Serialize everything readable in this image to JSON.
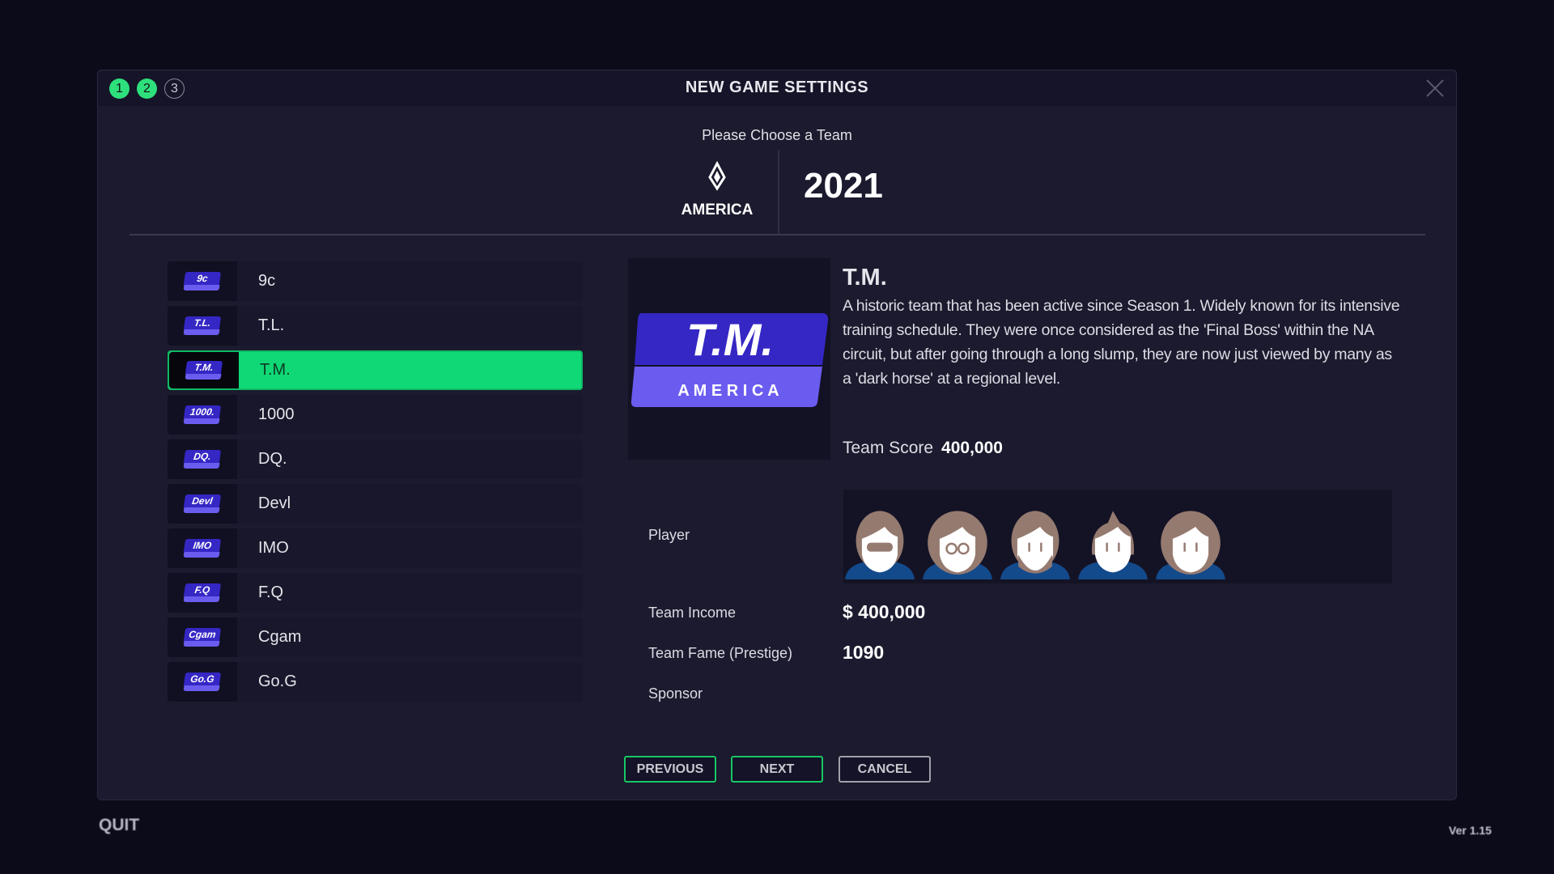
{
  "dialog": {
    "title": "NEW GAME  SETTINGS",
    "steps": [
      {
        "label": "1",
        "state": "done"
      },
      {
        "label": "2",
        "state": "done"
      },
      {
        "label": "3",
        "state": "todo"
      }
    ],
    "subtitle": "Please Choose a Team",
    "region": "AMERICA",
    "year": "2021"
  },
  "teams": [
    {
      "abbr": "9c",
      "name": "9c"
    },
    {
      "abbr": "T.L.",
      "name": "T.L."
    },
    {
      "abbr": "T.M.",
      "name": "T.M.",
      "selected": true
    },
    {
      "abbr": "1000.",
      "name": "1000"
    },
    {
      "abbr": "DQ.",
      "name": "DQ."
    },
    {
      "abbr": "Devl",
      "name": "Devl"
    },
    {
      "abbr": "IMO",
      "name": "IMO"
    },
    {
      "abbr": "F.Q",
      "name": "F.Q"
    },
    {
      "abbr": "Cgam",
      "name": "Cgam"
    },
    {
      "abbr": "Go.G",
      "name": "Go.G"
    }
  ],
  "detail": {
    "logo_text": "T.M.",
    "logo_sub": "A M E R I C A",
    "name": "T.M.",
    "description": "A historic team that has been active since Season 1. Widely known for its intensive training schedule. They were once considered as the 'Final Boss' within the NA circuit, but after going through a long slump, they are now just viewed by many as a 'dark horse' at a regional level.",
    "score_label": "Team Score",
    "score_value": "400,000",
    "player_label": "Player",
    "players": [
      "sunglasses",
      "glasses",
      "beard",
      "mohawk",
      "long-hair"
    ],
    "income_label": "Team Income",
    "income_value": "$ 400,000",
    "fame_label": "Team Fame (Prestige)",
    "fame_value": "1090",
    "sponsor_label": "Sponsor"
  },
  "buttons": {
    "previous": "PREVIOUS",
    "next": "NEXT",
    "cancel": "CANCEL"
  },
  "footer": {
    "quit": "QUIT",
    "version": "Ver 1.15"
  },
  "colors": {
    "accent": "#10d877",
    "logo_blue": "#3527c4",
    "logo_violet": "#6b5cf0",
    "shirt": "#134a8c",
    "hair": "#957a70"
  }
}
